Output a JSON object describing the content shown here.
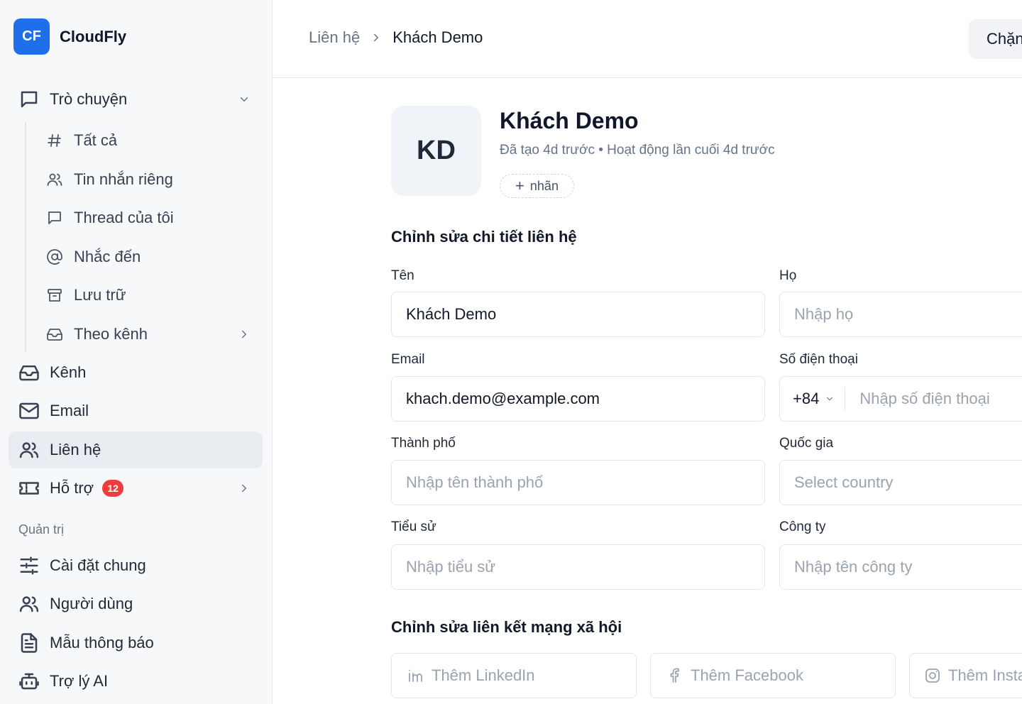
{
  "brand": {
    "logo": "CF",
    "name": "CloudFly",
    "color": "#1f6feb"
  },
  "sidebar": {
    "chat": {
      "label": "Trò chuyện",
      "icon": "chat-bubble-icon"
    },
    "chat_sub": [
      {
        "label": "Tất cả",
        "icon": "hash-icon"
      },
      {
        "label": "Tin nhắn riêng",
        "icon": "users-icon"
      },
      {
        "label": "Thread của tôi",
        "icon": "message-square-icon"
      },
      {
        "label": "Nhắc đến",
        "icon": "at-sign-icon"
      },
      {
        "label": "Lưu trữ",
        "icon": "archive-icon"
      },
      {
        "label": "Theo kênh",
        "icon": "inbox-icon"
      }
    ],
    "items": [
      {
        "label": "Kênh",
        "icon": "inbox-icon"
      },
      {
        "label": "Email",
        "icon": "mail-icon"
      },
      {
        "label": "Liên hệ",
        "icon": "contacts-icon",
        "active": true
      },
      {
        "label": "Hỗ trợ",
        "icon": "ticket-icon",
        "badge": "12"
      }
    ],
    "admin_label": "Quản trị",
    "admin_items": [
      {
        "label": "Cài đặt chung",
        "icon": "sliders-icon"
      },
      {
        "label": "Người dùng",
        "icon": "users-icon"
      },
      {
        "label": "Mẫu thông báo",
        "icon": "file-text-icon"
      },
      {
        "label": "Trợ lý AI",
        "icon": "bot-icon"
      }
    ],
    "badge_color": "#ef3b3b"
  },
  "header": {
    "breadcrumb": [
      "Liên hệ",
      "Khách Demo"
    ],
    "action_button": "Chặn"
  },
  "profile": {
    "initials": "KD",
    "name": "Khách Demo",
    "meta": "Đã tạo 4d trước • Hoạt động lần cuối 4d trước",
    "tag_button": "nhãn"
  },
  "form": {
    "title": "Chỉnh sửa chi tiết liên hệ",
    "first_name": {
      "label": "Tên",
      "value": "Khách Demo"
    },
    "last_name": {
      "label": "Họ",
      "placeholder": "Nhập họ"
    },
    "email": {
      "label": "Email",
      "value": "khach.demo@example.com"
    },
    "phone": {
      "label": "Số điện thoại",
      "code": "+84",
      "placeholder": "Nhập số điện thoại"
    },
    "city": {
      "label": "Thành phố",
      "placeholder": "Nhập tên thành phố"
    },
    "country": {
      "label": "Quốc gia",
      "placeholder": "Select country"
    },
    "bio": {
      "label": "Tiểu sử",
      "placeholder": "Nhập tiểu sử"
    },
    "company": {
      "label": "Công ty",
      "placeholder": "Nhập tên công ty"
    }
  },
  "social": {
    "title": "Chỉnh sửa liên kết mạng xã hội",
    "linkedin": "Thêm LinkedIn",
    "facebook": "Thêm Facebook",
    "instagram": "Thêm Instagram"
  }
}
